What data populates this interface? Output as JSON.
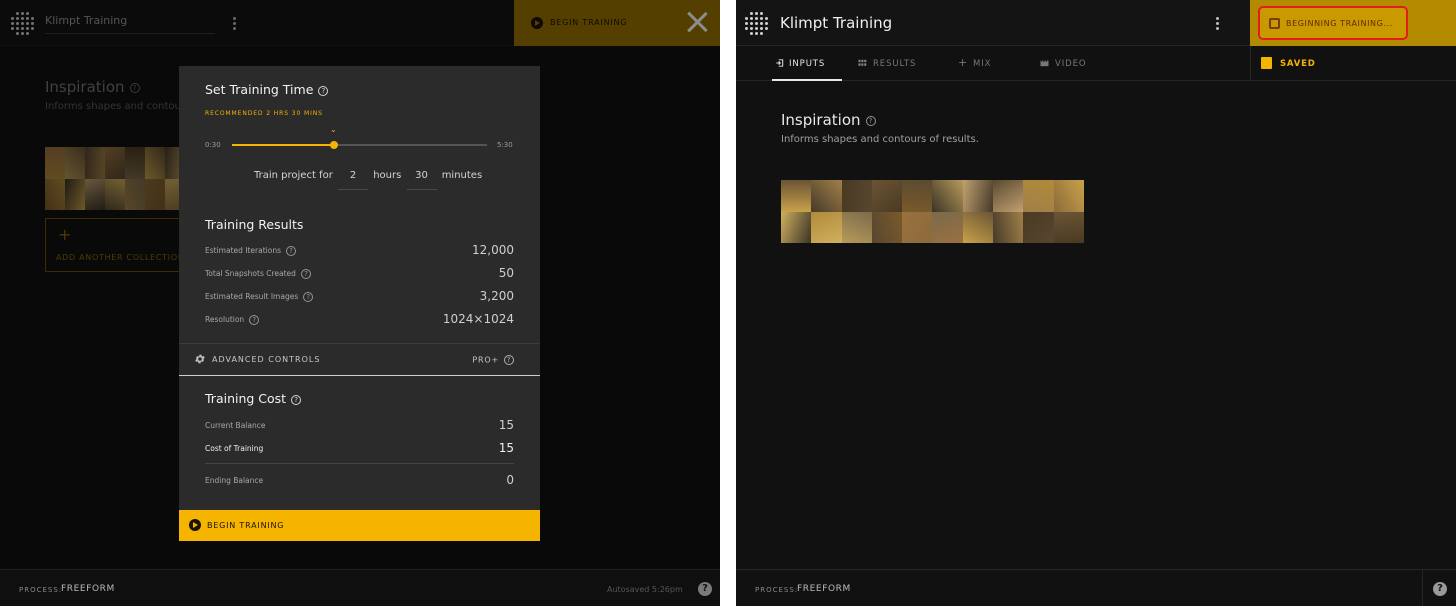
{
  "colors": {
    "accent": "#f5b400",
    "accent_dim": "#9b7400",
    "background": "#111111",
    "highlight_outline": "#e01e1e"
  },
  "left": {
    "header": {
      "project_title": "Klimpt Training",
      "begin_training_label": "BEGIN TRAINING",
      "close_icon": "close-icon",
      "menu_icon": "vertical-dots-icon"
    },
    "inspiration": {
      "title": "Inspiration",
      "subtitle": "Informs shapes and contours of results."
    },
    "add_collection_label": "ADD ANOTHER COLLECTION",
    "footer": {
      "process_key": "PROCESS:",
      "process_value": "FREEFORM",
      "autosaved": "Autosaved 5:26pm",
      "help": "?"
    },
    "modal": {
      "set_time_title": "Set Training Time",
      "recommended": "RECOMMENDED 2 HRS 30 MINS",
      "slider": {
        "min_label": "0:30",
        "max_label": "5:30",
        "level": 0.4
      },
      "train_prefix": "Train project for",
      "hours_value": "2",
      "hours_label": "hours",
      "minutes_value": "30",
      "minutes_label": "minutes",
      "results_title": "Training Results",
      "results": [
        {
          "label": "Estimated Iterations",
          "value": "12,000"
        },
        {
          "label": "Total Snapshots Created",
          "value": "50"
        },
        {
          "label": "Estimated Result Images",
          "value": "3,200"
        },
        {
          "label": "Resolution",
          "value": "1024×1024"
        }
      ],
      "advanced_label": "ADVANCED CONTROLS",
      "pro_label": "PRO+",
      "cost_title": "Training Cost",
      "current_balance_label": "Current Balance",
      "current_balance_value": "15",
      "cost_label": "Cost of Training",
      "cost_value": "15",
      "ending_balance_label": "Ending Balance",
      "ending_balance_value": "0",
      "begin_training_label": "BEGIN TRAINING"
    }
  },
  "right": {
    "header": {
      "project_title": "Klimpt Training",
      "status_button_label": "BEGINNING TRAINING...",
      "status_icon": "chip-icon",
      "menu_icon": "vertical-dots-icon"
    },
    "tabs": [
      {
        "label": "INPUTS",
        "icon": "input-icon",
        "active": true
      },
      {
        "label": "RESULTS",
        "icon": "grid-icon",
        "active": false
      },
      {
        "label": "MIX",
        "icon": "plus-icon",
        "active": false
      },
      {
        "label": "VIDEO",
        "icon": "film-icon",
        "active": false
      }
    ],
    "saved_label": "SAVED",
    "inspiration": {
      "title": "Inspiration",
      "subtitle": "Informs shapes and contours of results."
    },
    "footer": {
      "process_key": "PROCESS:",
      "process_value": "FREEFORM",
      "help": "?"
    }
  }
}
